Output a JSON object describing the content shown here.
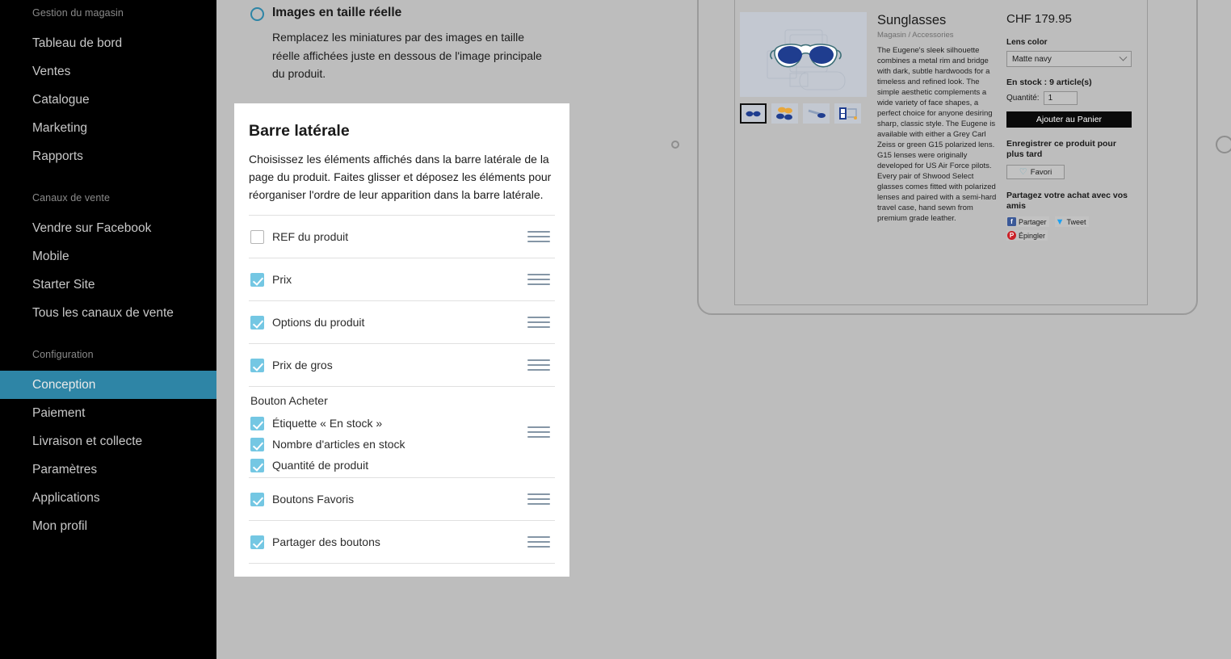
{
  "sidebar": {
    "sections": [
      {
        "label": "Gestion du magasin",
        "items": [
          {
            "label": "Tableau de bord",
            "active": false
          },
          {
            "label": "Ventes",
            "active": false
          },
          {
            "label": "Catalogue",
            "active": false
          },
          {
            "label": "Marketing",
            "active": false
          },
          {
            "label": "Rapports",
            "active": false
          }
        ]
      },
      {
        "label": "Canaux de vente",
        "items": [
          {
            "label": "Vendre sur Facebook",
            "active": false
          },
          {
            "label": "Mobile",
            "active": false
          },
          {
            "label": "Starter Site",
            "active": false
          },
          {
            "label": "Tous les canaux de vente",
            "active": false
          }
        ]
      },
      {
        "label": "Configuration",
        "items": [
          {
            "label": "Conception",
            "active": true
          },
          {
            "label": "Paiement",
            "active": false
          },
          {
            "label": "Livraison et collecte",
            "active": false
          },
          {
            "label": "Paramètres",
            "active": false
          },
          {
            "label": "Applications",
            "active": false
          },
          {
            "label": "Mon profil",
            "active": false
          }
        ]
      }
    ],
    "active_color": "#2e85a6"
  },
  "option": {
    "title": "Images en taille réelle",
    "description": "Remplacez les miniatures par des images en taille réelle affichées juste en dessous de l'image principale du produit.",
    "selected": false,
    "accent_color": "#2e85a6"
  },
  "card": {
    "title": "Barre latérale",
    "description": "Choisissez les éléments affichés dans la barre latérale de la page du produit. Faites glisser et déposez les éléments pour réorganiser l'ordre de leur apparition dans la barre latérale.",
    "checkbox_color": "#74c7e3",
    "rows": [
      {
        "group_label": null,
        "draggable": true,
        "items": [
          {
            "label": "REF du produit",
            "checked": false
          }
        ]
      },
      {
        "group_label": null,
        "draggable": true,
        "items": [
          {
            "label": "Prix",
            "checked": true
          }
        ]
      },
      {
        "group_label": null,
        "draggable": true,
        "items": [
          {
            "label": "Options du produit",
            "checked": true
          }
        ]
      },
      {
        "group_label": null,
        "draggable": true,
        "items": [
          {
            "label": "Prix de gros",
            "checked": true
          }
        ]
      },
      {
        "group_label": "Bouton Acheter",
        "draggable": true,
        "items": [
          {
            "label": "Étiquette « En stock »",
            "checked": true
          },
          {
            "label": "Nombre d'articles en stock",
            "checked": true
          },
          {
            "label": "Quantité de produit",
            "checked": true
          }
        ]
      },
      {
        "group_label": null,
        "draggable": true,
        "items": [
          {
            "label": "Boutons Favoris",
            "checked": true
          }
        ]
      },
      {
        "group_label": null,
        "draggable": true,
        "items": [
          {
            "label": "Partager des boutons",
            "checked": true
          }
        ]
      }
    ]
  },
  "preview": {
    "product": {
      "title": "Sunglasses",
      "breadcrumb": "Magasin  /  Accessories",
      "description": "The Eugene's sleek silhouette combines a metal rim and bridge with dark, subtle hardwoods for a timeless and refined look. The simple aesthetic complements a wide variety of face shapes, a perfect choice for anyone desiring sharp, classic style. The Eugene is available with either a Grey Carl Zeiss or green G15 polarized lens. G15 lenses were originally developed for US Air Force pilots. Every pair of Shwood Select glasses comes fitted with polarized lenses and paired with a semi-hard travel case, hand sewn from premium grade leather.",
      "price": "CHF 179.95",
      "option_label": "Lens color",
      "option_value": "Matte navy",
      "stock_text": "En stock : 9 article(s)",
      "quantity_label": "Quantité:",
      "quantity_value": "1",
      "add_to_cart": "Ajouter au Panier",
      "save_heading": "Enregistrer ce produit pour plus tard",
      "favorite_label": "Favori",
      "share_heading": "Partagez votre achat avec vos amis",
      "share_buttons": [
        {
          "label": "Partager",
          "network": "facebook",
          "glyph": "f",
          "color": "#3b5998"
        },
        {
          "label": "Tweet",
          "network": "twitter",
          "glyph": "▼",
          "color": "#1da1f2"
        },
        {
          "label": "Épingler",
          "network": "pinterest",
          "glyph": "P",
          "color": "#cb2027"
        }
      ],
      "thumbnails": [
        {
          "selected": true
        },
        {
          "selected": false
        },
        {
          "selected": false
        },
        {
          "selected": false
        }
      ]
    }
  }
}
